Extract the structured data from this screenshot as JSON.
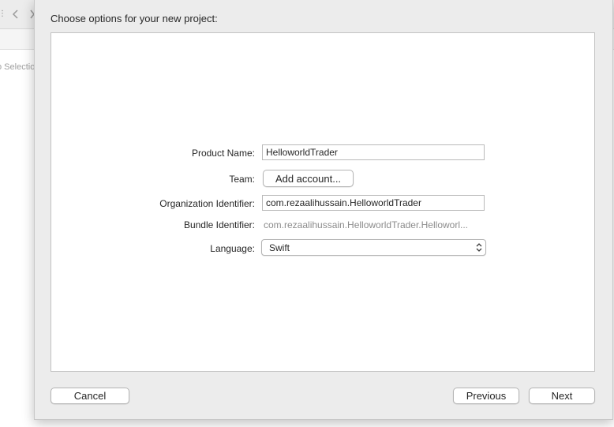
{
  "background": {
    "no_selection_label": "o Selectio"
  },
  "sheet": {
    "title": "Choose options for your new project:"
  },
  "form": {
    "product_name": {
      "label": "Product Name:",
      "value": "HelloworldTrader"
    },
    "team": {
      "label": "Team:",
      "button_label": "Add account..."
    },
    "organization_identifier": {
      "label": "Organization Identifier:",
      "value": "com.rezaalihussain.HelloworldTrader"
    },
    "bundle_identifier": {
      "label": "Bundle Identifier:",
      "value": "com.rezaalihussain.HelloworldTrader.Helloworl..."
    },
    "language": {
      "label": "Language:",
      "value": "Swift"
    }
  },
  "buttons": {
    "cancel": "Cancel",
    "previous": "Previous",
    "next": "Next"
  },
  "icons": {
    "back": "chevron-left-icon",
    "forward": "chevron-right-icon",
    "popup": "updown-chevron-icon"
  },
  "colors": {
    "sheet_background": "#ececec",
    "panel_background": "#ffffff",
    "text": "#262626",
    "secondary_text": "#8c8c8c"
  }
}
